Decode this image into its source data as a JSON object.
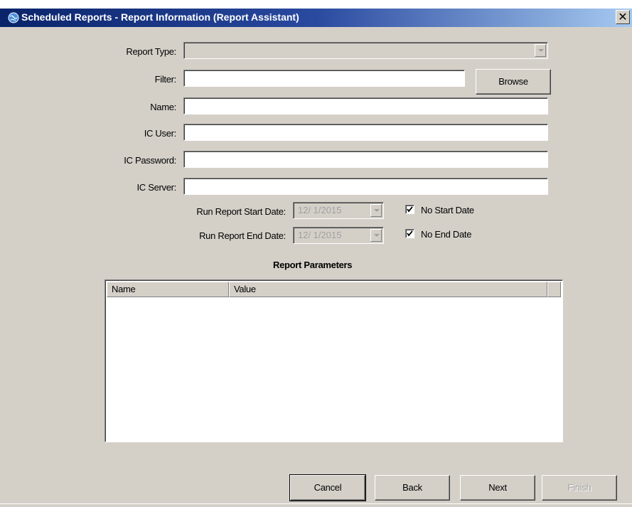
{
  "window": {
    "title": "Scheduled Reports - Report Information (Report Assistant)",
    "close_glyph": "✕",
    "icon": "globe-icon"
  },
  "form": {
    "report_type_label": "Report Type:",
    "report_type_value": "",
    "filter_label": "Filter:",
    "filter_value": "",
    "browse_label": "Browse",
    "name_label": "Name:",
    "name_value": "",
    "ic_user_label": "IC User:",
    "ic_user_value": "",
    "ic_password_label": "IC Password:",
    "ic_password_value": "",
    "ic_server_label": "IC Server:",
    "ic_server_value": ""
  },
  "dates": {
    "start_label": "Run Report Start Date:",
    "start_value": "12/  1/2015",
    "no_start_label": "No Start Date",
    "no_start_checked": true,
    "end_label": "Run Report End Date:",
    "end_value": "12/  1/2015",
    "no_end_label": "No End Date",
    "no_end_checked": true
  },
  "parameters": {
    "title": "Report Parameters",
    "columns": [
      "Name",
      "Value"
    ],
    "rows": []
  },
  "buttons": {
    "cancel": "Cancel",
    "back": "Back",
    "next": "Next",
    "finish": "Finish"
  },
  "colors": {
    "window_bg": "#d4d0c8",
    "title_bar_start": "#0a246a",
    "title_bar_end": "#a6caf0",
    "disabled_text": "#a0a0a0"
  }
}
